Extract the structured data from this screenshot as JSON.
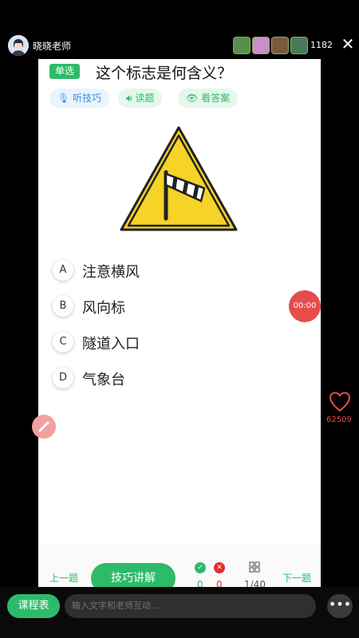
{
  "header": {
    "host_name": "晓晓老师",
    "viewer_count": "1182",
    "close_glyph": "✕"
  },
  "question": {
    "type_label": "单选",
    "title": "这个标志是何含义？",
    "tips_label": "听技巧",
    "read_label": "读题",
    "answer_label": "看答案",
    "sign_icon": "windsock-warning-sign",
    "options": [
      {
        "letter": "A",
        "text": "注意横风"
      },
      {
        "letter": "B",
        "text": "风向标"
      },
      {
        "letter": "C",
        "text": "隧道入口"
      },
      {
        "letter": "D",
        "text": "气象台"
      }
    ]
  },
  "footer": {
    "prev_label": "上一题",
    "explain_label": "技巧讲解",
    "correct_count": "0",
    "wrong_count": "0",
    "progress": "1/40",
    "next_label": "下一题"
  },
  "overlay": {
    "timer": "00:00",
    "likes": "62509"
  },
  "bottom": {
    "schedule_label": "课程表",
    "chat_placeholder": "输入文字和老师互动...",
    "more_glyph": "•••"
  },
  "colors": {
    "accent": "#2dbb6a",
    "danger": "#e52b2b",
    "sign_yellow": "#f5d327"
  }
}
